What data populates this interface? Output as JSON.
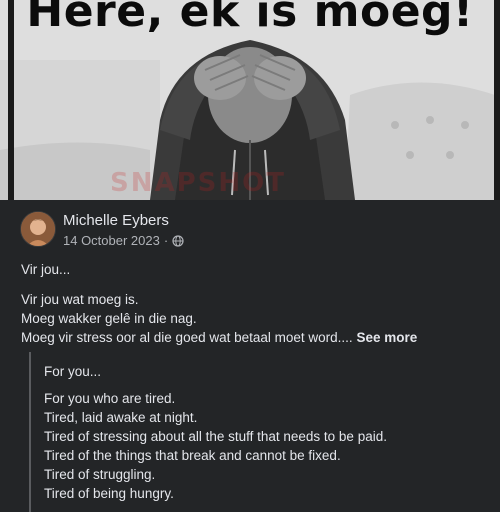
{
  "image": {
    "headline": "Here, ek is moeg!",
    "watermark": "SNAPSHOT"
  },
  "post": {
    "author": "Michelle Eybers",
    "date": "14 October 2023",
    "separator": "·",
    "privacy_icon": "globe-icon",
    "lines": [
      "Vir jou...",
      "Vir jou wat moeg is.",
      "Moeg wakker gelê in die nag.",
      "Moeg vir stress oor al die goed wat betaal moet word...."
    ],
    "see_more": "See more"
  },
  "translation": {
    "lines": [
      "For you...",
      "For you who are tired.",
      "Tired, laid awake at night.",
      "Tired of stressing about all the stuff that needs to be paid.",
      "Tired of the things that break and cannot be fixed.",
      "Tired of struggling.",
      "Tired of being hungry."
    ]
  },
  "colors": {
    "background": "#232527",
    "text": "#e4e6eb",
    "secondary_text": "#b0b3b8"
  }
}
